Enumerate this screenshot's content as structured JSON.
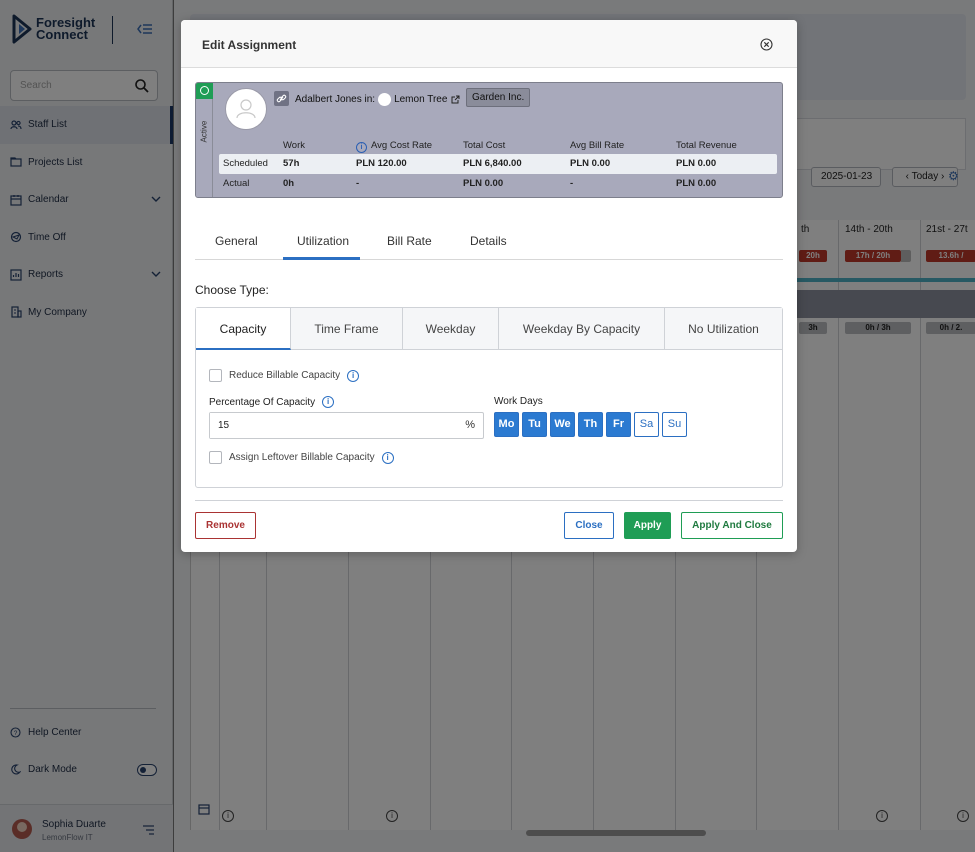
{
  "brand": {
    "line1": "Foresight",
    "line2": "Connect"
  },
  "sidebar": {
    "search_placeholder": "Search",
    "items": [
      {
        "label": "Staff List",
        "icon": "users-icon"
      },
      {
        "label": "Projects List",
        "icon": "folder-icon"
      },
      {
        "label": "Calendar",
        "icon": "calendar-icon"
      },
      {
        "label": "Time Off",
        "icon": "plane-icon"
      },
      {
        "label": "Reports",
        "icon": "report-icon"
      },
      {
        "label": "My Company",
        "icon": "building-icon"
      }
    ],
    "help_center": "Help Center",
    "dark_mode": "Dark Mode",
    "user": {
      "name": "Sophia Duarte",
      "org": "LemonFlow IT"
    }
  },
  "background": {
    "date": "2025-01-23",
    "today": "Today",
    "weeks": [
      "th",
      "14th - 20th",
      "21st - 27t"
    ],
    "red_pills": [
      "20h",
      "17h / 20h",
      "13.6h /"
    ],
    "gray_pills": [
      "3h",
      "0h / 3h",
      "0h / 2."
    ]
  },
  "modal": {
    "title": "Edit Assignment",
    "card": {
      "status": "Active",
      "person_line": "Adalbert Jones in:",
      "project": "Lemon Tree",
      "client": "Garden Inc.",
      "columns": [
        "Work",
        "Avg Cost Rate",
        "Total Cost",
        "Avg Bill Rate",
        "Total Revenue"
      ],
      "rows": [
        {
          "label": "Scheduled",
          "values": [
            "57h",
            "PLN 120.00",
            "PLN 6,840.00",
            "PLN 0.00",
            "PLN 0.00"
          ]
        },
        {
          "label": "Actual",
          "values": [
            "0h",
            "-",
            "PLN 0.00",
            "-",
            "PLN 0.00"
          ]
        }
      ]
    },
    "tabs": [
      "General",
      "Utilization",
      "Bill Rate",
      "Details"
    ],
    "active_tab": "Utilization",
    "choose_type": "Choose Type:",
    "types": [
      "Capacity",
      "Time Frame",
      "Weekday",
      "Weekday By Capacity",
      "No Utilization"
    ],
    "active_type": "Capacity",
    "reduce_billable": "Reduce Billable Capacity",
    "percentage_label": "Percentage Of Capacity",
    "percentage_value": "15",
    "percent_suffix": "%",
    "work_days_label": "Work Days",
    "work_days": [
      {
        "label": "Mo",
        "on": true
      },
      {
        "label": "Tu",
        "on": true
      },
      {
        "label": "We",
        "on": true
      },
      {
        "label": "Th",
        "on": true
      },
      {
        "label": "Fr",
        "on": true
      },
      {
        "label": "Sa",
        "on": false
      },
      {
        "label": "Su",
        "on": false
      }
    ],
    "assign_leftover": "Assign Leftover Billable Capacity",
    "buttons": {
      "remove": "Remove",
      "close": "Close",
      "apply": "Apply",
      "apply_close": "Apply And Close"
    }
  },
  "colors": {
    "accent": "#2b7ad1",
    "success": "#1f9d55",
    "danger": "#aa3333",
    "navy": "#1d3557"
  }
}
